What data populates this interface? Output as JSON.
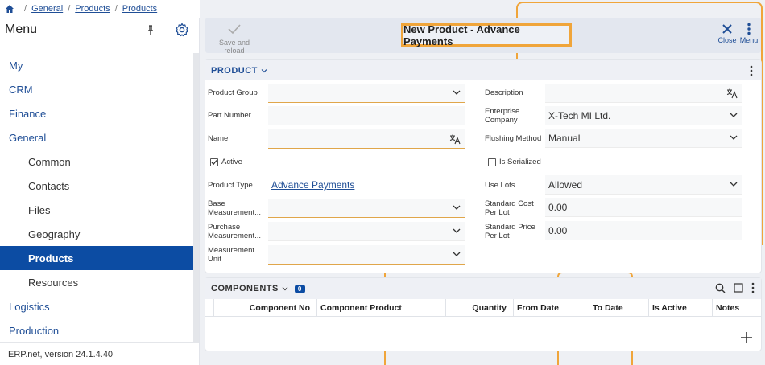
{
  "breadcrumb": {
    "items": [
      "General",
      "Products",
      "Products"
    ]
  },
  "sidebar": {
    "title": "Menu",
    "items": [
      {
        "label": "My",
        "level": "top"
      },
      {
        "label": "CRM",
        "level": "top"
      },
      {
        "label": "Finance",
        "level": "top"
      },
      {
        "label": "General",
        "level": "top"
      },
      {
        "label": "Common",
        "level": "sub"
      },
      {
        "label": "Contacts",
        "level": "sub"
      },
      {
        "label": "Files",
        "level": "sub"
      },
      {
        "label": "Geography",
        "level": "sub"
      },
      {
        "label": "Products",
        "level": "sub",
        "active": true
      },
      {
        "label": "Resources",
        "level": "sub"
      },
      {
        "label": "Logistics",
        "level": "top"
      },
      {
        "label": "Production",
        "level": "top"
      }
    ],
    "footer": "ERP.net, version 24.1.4.40"
  },
  "toolbar": {
    "save_label": "Save and reload",
    "title": "New Product - Advance Payments",
    "close_label": "Close",
    "menu_label": "Menu"
  },
  "product": {
    "section_title": "PRODUCT",
    "product_group_label": "Product Group",
    "part_number_label": "Part Number",
    "name_label": "Name",
    "active_label": "Active",
    "product_type_label": "Product Type",
    "product_type_value": "Advance Payments",
    "base_mu_label_1": "Base",
    "base_mu_label_2": "Measurement...",
    "purchase_mu_label_1": "Purchase",
    "purchase_mu_label_2": "Measurement...",
    "mu_label_1": "Measurement",
    "mu_label_2": "Unit",
    "description_label": "Description",
    "enterprise_label_1": "Enterprise",
    "enterprise_label_2": "Company",
    "enterprise_value": "X-Tech MI Ltd.",
    "flushing_label": "Flushing Method",
    "flushing_value": "Manual",
    "serialized_label": "Is Serialized",
    "use_lots_label": "Use Lots",
    "use_lots_value": "Allowed",
    "std_cost_label_1": "Standard Cost",
    "std_cost_label_2": "Per Lot",
    "std_cost_value": "0.00",
    "std_price_label_1": "Standard Price",
    "std_price_label_2": "Per Lot",
    "std_price_value": "0.00"
  },
  "components": {
    "title": "COMPONENTS",
    "count": "0",
    "columns": [
      "Component No",
      "Component Product",
      "Quantity",
      "From Date",
      "To Date",
      "Is Active",
      "Notes"
    ]
  },
  "colors": {
    "accent": "#0c4ca3",
    "callout": "#f0a53a",
    "link": "#1f4e96"
  }
}
